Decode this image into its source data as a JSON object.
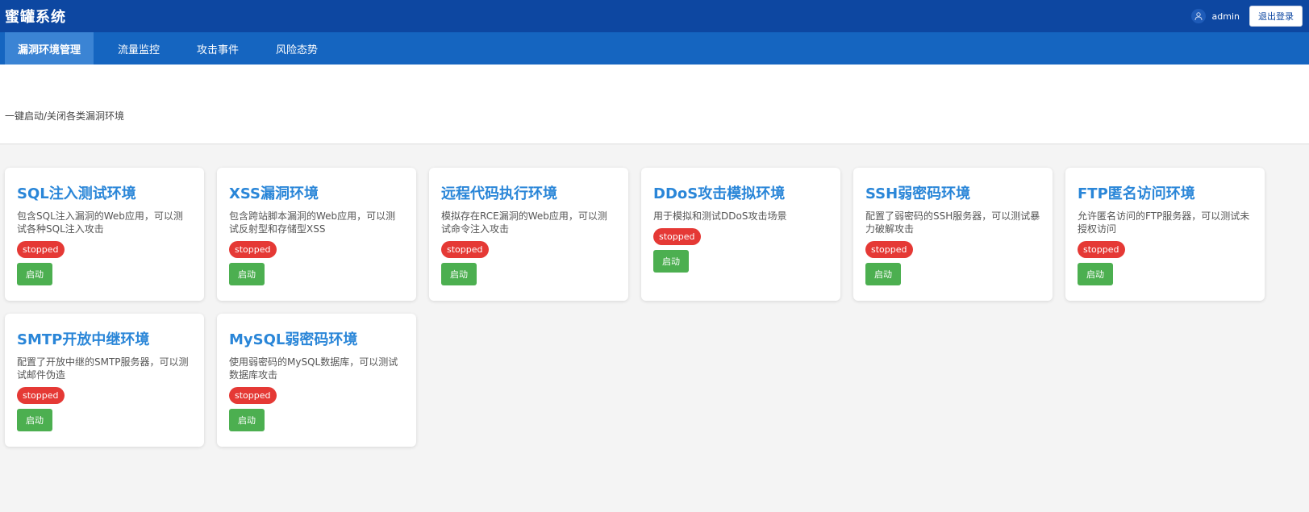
{
  "app": {
    "title": "蜜罐系统",
    "user_name": "admin",
    "logout_label": "退出登录",
    "user_icon": "user-icon"
  },
  "nav": {
    "tabs": [
      {
        "label": "漏洞环境管理",
        "active": true
      },
      {
        "label": "流量监控",
        "active": false
      },
      {
        "label": "攻击事件",
        "active": false
      },
      {
        "label": "风险态势",
        "active": false
      }
    ]
  },
  "header": {
    "subtitle": "一键启动/关闭各类漏洞环境"
  },
  "cards": [
    {
      "title": "SQL注入测试环境",
      "desc": "包含SQL注入漏洞的Web应用，可以测试各种SQL注入攻击",
      "status": "stopped",
      "button": "启动"
    },
    {
      "title": "XSS漏洞环境",
      "desc": "包含跨站脚本漏洞的Web应用，可以测试反射型和存储型XSS",
      "status": "stopped",
      "button": "启动"
    },
    {
      "title": "远程代码执行环境",
      "desc": "模拟存在RCE漏洞的Web应用，可以测试命令注入攻击",
      "status": "stopped",
      "button": "启动"
    },
    {
      "title": "DDoS攻击模拟环境",
      "desc": "用于模拟和测试DDoS攻击场景",
      "status": "stopped",
      "button": "启动"
    },
    {
      "title": "SSH弱密码环境",
      "desc": "配置了弱密码的SSH服务器，可以测试暴力破解攻击",
      "status": "stopped",
      "button": "启动"
    },
    {
      "title": "FTP匿名访问环境",
      "desc": "允许匿名访问的FTP服务器，可以测试未授权访问",
      "status": "stopped",
      "button": "启动"
    },
    {
      "title": "SMTP开放中继环境",
      "desc": "配置了开放中继的SMTP服务器，可以测试邮件伪造",
      "status": "stopped",
      "button": "启动"
    },
    {
      "title": "MySQL弱密码环境",
      "desc": "使用弱密码的MySQL数据库，可以测试数据库攻击",
      "status": "stopped",
      "button": "启动"
    }
  ],
  "colors": {
    "topbar": "#0d47a1",
    "navbar": "#1565c0",
    "nav_active": "#3b84d4",
    "card_title": "#2a86d8",
    "status_stopped": "#e53935",
    "start_button": "#4caf50"
  }
}
